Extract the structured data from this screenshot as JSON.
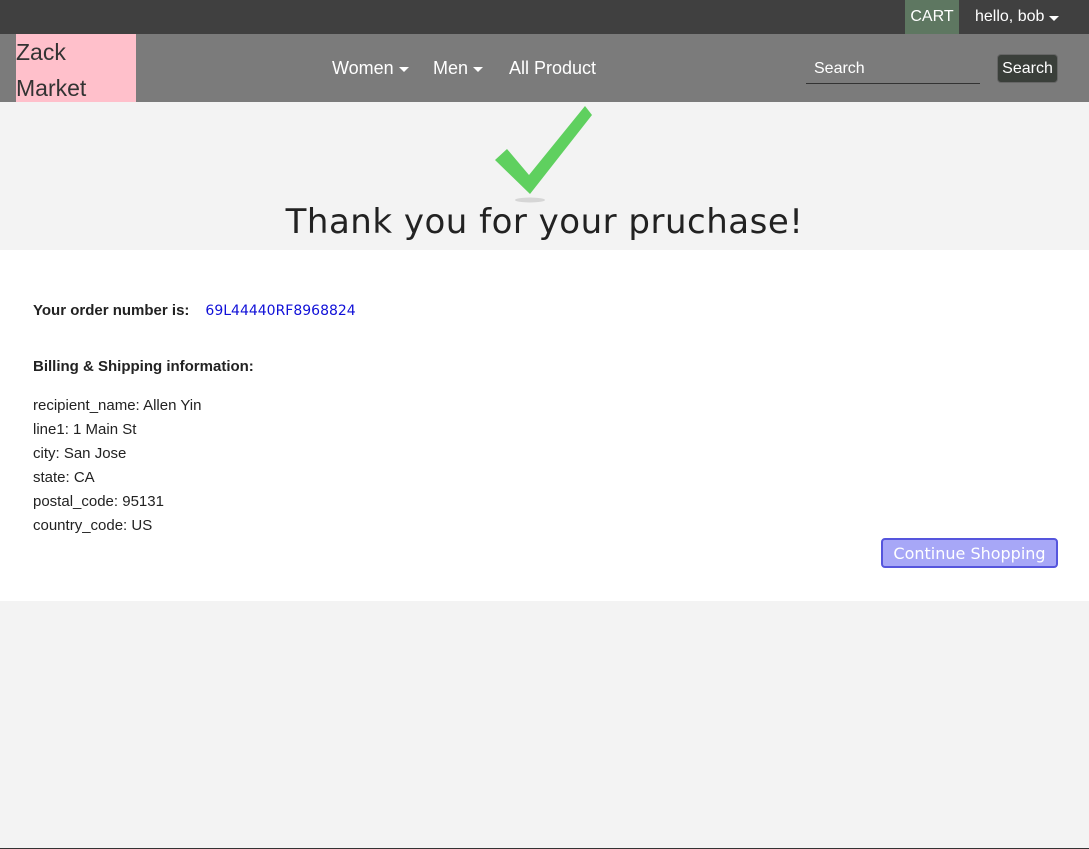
{
  "topbar": {
    "cart_label": "CART",
    "user_label": "hello, bob"
  },
  "navbar": {
    "brand_line1": "Zack",
    "brand_line2": "Market",
    "links": [
      "Women",
      "Men",
      "All Product"
    ],
    "search_placeholder": "Search",
    "search_button": "Search"
  },
  "hero": {
    "title": "Thank you for your pruchase!",
    "icon": "checkmark-icon"
  },
  "order": {
    "label": "Your order number is:",
    "number": "69L44440RF8968824"
  },
  "billing": {
    "title": "Billing & Shipping information:",
    "fields": [
      "recipient_name: Allen Yin",
      "line1: 1 Main St",
      "city: San Jose",
      "state: CA",
      "postal_code: 95131",
      "country_code: US"
    ]
  },
  "actions": {
    "continue_label": "Continue Shopping"
  },
  "colors": {
    "topbar": "#404040",
    "navbar": "#7b7b7b",
    "brand_bg": "#ffc0cb",
    "cart_bg": "#5e7761",
    "check": "#5fd05f",
    "order_number": "#1010d8",
    "continue_bg": "#a7a7f7"
  }
}
